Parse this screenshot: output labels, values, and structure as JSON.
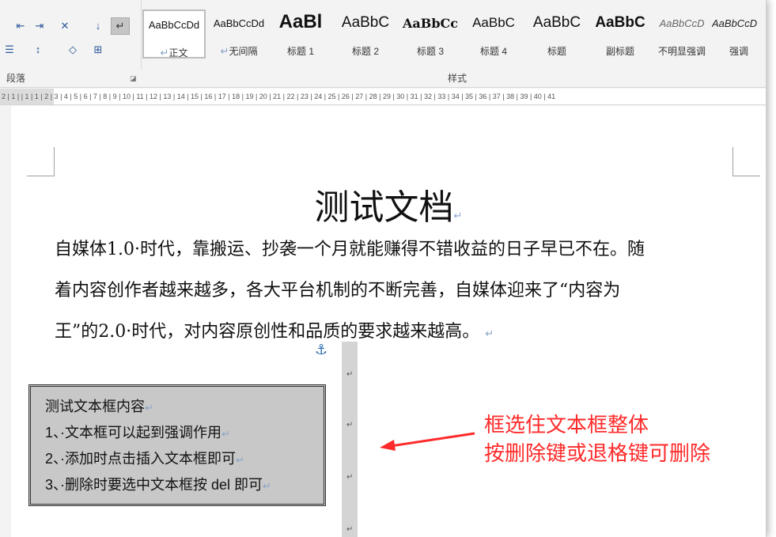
{
  "ribbon": {
    "paragraph_group_label": "段落",
    "styles_group_label": "样式",
    "styles": [
      {
        "preview": "AaBbCcDd",
        "name": "正文",
        "selected": true
      },
      {
        "preview": "AaBbCcDd",
        "name": "无间隔"
      },
      {
        "preview": "AaBl",
        "name": "标题 1"
      },
      {
        "preview": "AaBbC",
        "name": "标题 2"
      },
      {
        "preview": "AaBbCc",
        "name": "标题 3"
      },
      {
        "preview": "AaBbC",
        "name": "标题 4"
      },
      {
        "preview": "AaBbC",
        "name": "标题"
      },
      {
        "preview": "AaBbC",
        "name": "副标题"
      },
      {
        "preview": "AaBbCcD",
        "name": "不明显强调"
      },
      {
        "preview": "AaBbCcD",
        "name": "强调"
      }
    ]
  },
  "ruler": {
    "text": "2 | 1 |   | 1 | 1 | 2 | 3 | 4 | 5 | 6 | 7 | 8 | 9 | 10 | 11 | 12 | 13 | 14 | 15 | 16 | 17 | 18 | 19 | 20 | 21 | 22 | 23 | 24 | 25 | 26 | 27 | 28 | 29 | 30 | 31 | 32 | 33 | 34 | 35 | 36 | 37 | 38 | 39 | 40 | 41"
  },
  "document": {
    "title": "测试文档",
    "paragraph_lines": [
      "自媒体1.0·时代，靠搬运、抄袭一个月就能赚得不错收益的日子早已不在。随",
      "着内容创作者越来越多，各大平台机制的不断完善，自媒体迎来了“内容为",
      "王”的2.0·时代，对内容原创性和品质的要求越来越高。"
    ],
    "paragraph_mark": "↵",
    "textbox_lines": [
      "测试文本框内容",
      "1、·文本框可以起到强调作用",
      "2、·添加时点击插入文本框即可",
      "3、·删除时要选中文本框按 del 即可"
    ]
  },
  "annotation": {
    "line1": "框选住文本框整体",
    "line2": "按删除键或退格键可删除",
    "color": "#ff2a2a"
  }
}
